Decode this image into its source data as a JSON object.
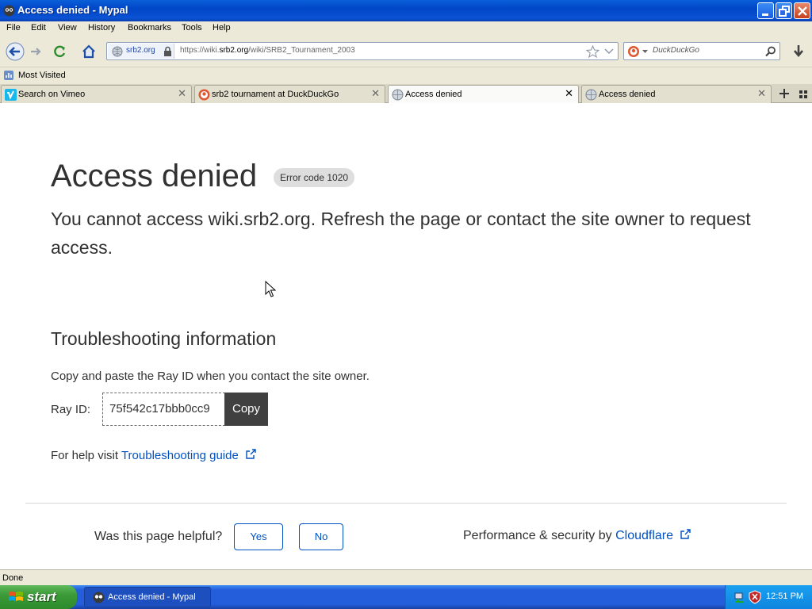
{
  "window": {
    "title": "Access denied - Mypal"
  },
  "menu": [
    "File",
    "Edit",
    "View",
    "History",
    "Bookmarks",
    "Tools",
    "Help"
  ],
  "urlbar": {
    "identity": "srb2.org",
    "url_prefix": "https://wiki.",
    "url_domain": "srb2.org",
    "url_path": "/wiki/SRB2_Tournament_2003"
  },
  "search": {
    "placeholder": "DuckDuckGo"
  },
  "bookmarks": {
    "most_visited": "Most Visited"
  },
  "tabs": [
    {
      "label": "Search on Vimeo"
    },
    {
      "label": "srb2 tournament at DuckDuckGo"
    },
    {
      "label": "Access denied"
    },
    {
      "label": "Access denied"
    }
  ],
  "page": {
    "heading": "Access denied",
    "error_badge": "Error code 1020",
    "lead": "You cannot access wiki.srb2.org. Refresh the page or contact the site owner to request access.",
    "troubleshooting_title": "Troubleshooting information",
    "copy_instruction": "Copy and paste the Ray ID when you contact the site owner.",
    "ray_label": "Ray ID:",
    "ray_id": "75f542c17bbb0cc9",
    "copy_button": "Copy",
    "help_prefix": "For help visit",
    "help_link": "Troubleshooting guide",
    "helpful_question": "Was this page helpful?",
    "yes": "Yes",
    "no": "No",
    "perf_prefix": "Performance & security by",
    "perf_link": "Cloudflare"
  },
  "status": {
    "text": "Done"
  },
  "taskbar": {
    "start": "start",
    "item": "Access denied - Mypal",
    "clock": "12:51 PM"
  }
}
